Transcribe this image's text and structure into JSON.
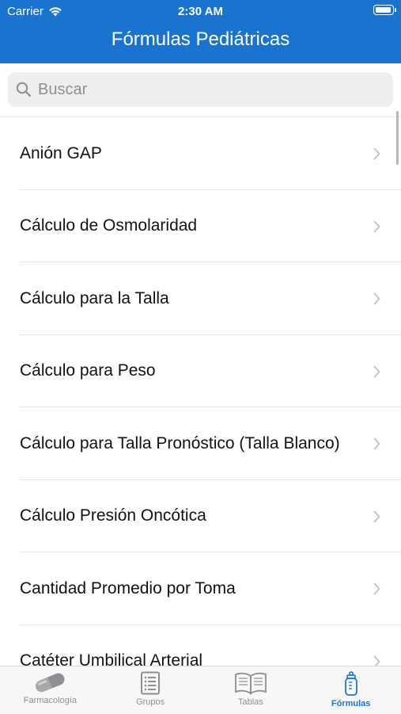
{
  "status": {
    "carrier": "Carrier",
    "time": "2:30 AM"
  },
  "header": {
    "title": "Fórmulas Pediátricas"
  },
  "search": {
    "placeholder": "Buscar"
  },
  "list": {
    "items": [
      {
        "label": "Anión GAP"
      },
      {
        "label": "Cálculo de Osmolaridad"
      },
      {
        "label": "Cálculo para la Talla"
      },
      {
        "label": "Cálculo para Peso"
      },
      {
        "label": "Cálculo para Talla Pronóstico (Talla Blanco)"
      },
      {
        "label": "Cálculo Presión Oncótica"
      },
      {
        "label": "Cantidad Promedio por Toma"
      },
      {
        "label": "Catéter Umbilical Arterial"
      }
    ]
  },
  "tabs": [
    {
      "label": "Farmacología",
      "icon": "pill-icon"
    },
    {
      "label": "Grupos",
      "icon": "list-icon"
    },
    {
      "label": "Tablas",
      "icon": "book-icon"
    },
    {
      "label": "Fórmulas",
      "icon": "baby-bottle-icon",
      "active": true
    }
  ],
  "colors": {
    "accent": "#1a74cf",
    "inactive": "#8e8e93"
  }
}
